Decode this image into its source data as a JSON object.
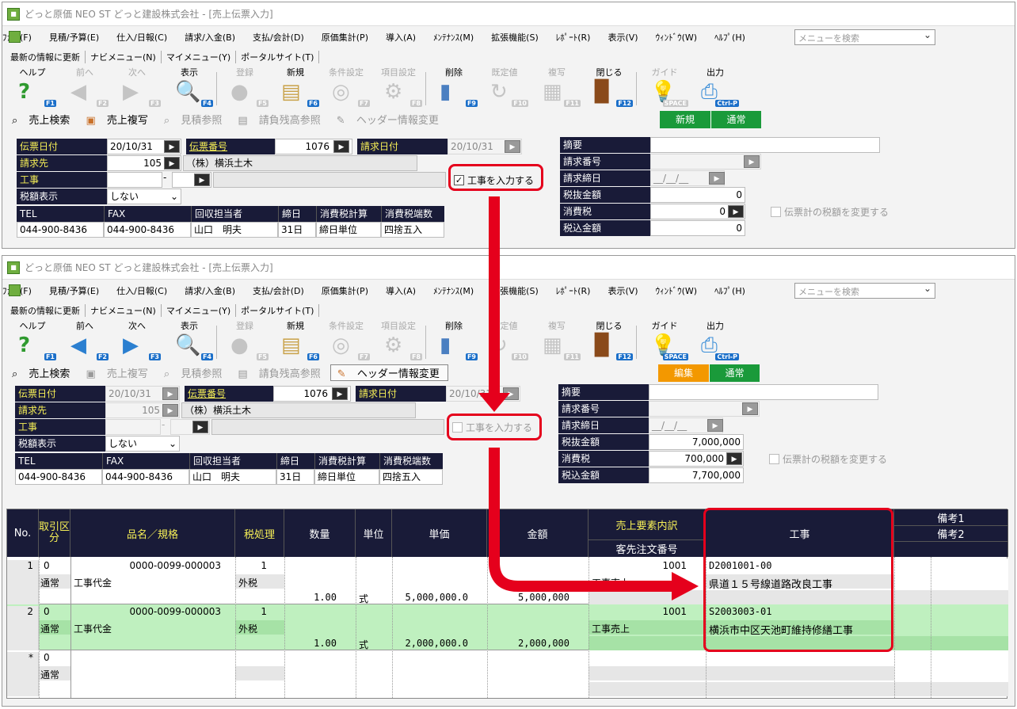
{
  "window_title": "どっと原価 NEO ST どっと建設株式会社 - [売上伝票入力]",
  "menu": [
    "ﾌｧｲﾙ(F)",
    "見積/予算(E)",
    "仕入/日報(C)",
    "請求/入金(B)",
    "支払/会計(D)",
    "原価集計(P)",
    "導入(A)",
    "ﾒﾝﾃﾅﾝｽ(M)",
    "拡張機能(S)",
    "ﾚﾎﾟｰﾄ(R)",
    "表示(V)",
    "ｳｨﾝﾄﾞｳ(W)",
    "ﾍﾙﾌﾟ(H)"
  ],
  "search_placeholder": "メニューを検索",
  "links": [
    "最新の情報に更新",
    "ナビメニュー(N)",
    "マイメニュー(Y)",
    "ポータルサイト(T)"
  ],
  "toolbar": [
    {
      "label": "ヘルプ",
      "key": "F1",
      "icon": "help-icon"
    },
    {
      "label": "前へ",
      "key": "F2",
      "icon": "arrow-left-icon"
    },
    {
      "label": "次へ",
      "key": "F3",
      "icon": "arrow-right-icon"
    },
    {
      "label": "表示",
      "key": "F4",
      "icon": "magnifier-icon"
    },
    {
      "label": "登録",
      "key": "F5",
      "icon": "ok-icon"
    },
    {
      "label": "新規",
      "key": "F6",
      "icon": "new-doc-icon"
    },
    {
      "label": "条件設定",
      "key": "F7",
      "icon": "condition-icon"
    },
    {
      "label": "項目設定",
      "key": "F8",
      "icon": "item-settings-icon"
    },
    {
      "label": "削除",
      "key": "F9",
      "icon": "trash-icon"
    },
    {
      "label": "既定値",
      "key": "F10",
      "icon": "default-icon"
    },
    {
      "label": "複写",
      "key": "F11",
      "icon": "copy-icon"
    },
    {
      "label": "閉じる",
      "key": "F12",
      "icon": "door-icon"
    },
    {
      "label": "ガイド",
      "key": "SPACE",
      "icon": "bulb-icon"
    },
    {
      "label": "出力",
      "key": "Ctrl-P",
      "icon": "output-icon"
    }
  ],
  "subbar": [
    "売上検索",
    "売上複写",
    "見積参照",
    "請負残高参照",
    "ヘッダー情報変更"
  ],
  "modes": {
    "new": "新規",
    "edit": "編集",
    "normal": "通常"
  },
  "header": {
    "slip_date_label": "伝票日付",
    "slip_date": "20/10/31",
    "slip_no_label": "伝票番号",
    "slip_no": "1076",
    "bill_date_label": "請求日付",
    "bill_date": "20/10/31",
    "customer_label": "請求先",
    "customer_code": "105",
    "customer_name": "（株）横浜土木",
    "project_label": "工事",
    "tax_display_label": "税額表示",
    "tax_display": "しない",
    "input_project_label": "工事を入力する",
    "info_headers": [
      "TEL",
      "FAX",
      "回収担当者",
      "締日",
      "消費税計算",
      "消費税端数"
    ],
    "info_values": [
      "044-900-8436",
      "044-900-8436",
      "山口　明夫",
      "31日",
      "締日単位",
      "四捨五入"
    ]
  },
  "summary": {
    "labels": [
      "摘要",
      "請求番号",
      "請求締日",
      "税抜金額",
      "消費税",
      "税込金額"
    ],
    "bill_close": "__/__/__",
    "w1": {
      "net": "0",
      "tax": "0",
      "gross": "0"
    },
    "w2": {
      "net": "7,000,000",
      "tax": "700,000",
      "gross": "7,700,000"
    },
    "change_tax_label": "伝票計の税額を変更する"
  },
  "grid": {
    "headers": {
      "no": "No.",
      "kind": "取引区分",
      "name": "品名／規格",
      "tax": "税処理",
      "qty": "数量",
      "unit": "単位",
      "price": "単価",
      "amount": "金額",
      "elem": "売上要素内訳",
      "order": "客先注文番号",
      "project": "工事",
      "rem1": "備考1",
      "rem2": "備考2"
    },
    "rows": [
      {
        "no": "1",
        "kind_code": "0",
        "kind": "通常",
        "code": "0000-0099-000003",
        "name": "工事代金",
        "tax_code": "1",
        "tax": "外税",
        "qty": "1.00",
        "unit": "式",
        "price": "5,000,000.0",
        "amount": "5,000,000",
        "elem_code": "1001",
        "elem": "工事売上",
        "proj_code": "D2001001-00",
        "proj_name": "県道１５号線道路改良工事"
      },
      {
        "no": "2",
        "kind_code": "0",
        "kind": "通常",
        "code": "0000-0099-000003",
        "name": "工事代金",
        "tax_code": "1",
        "tax": "外税",
        "qty": "1.00",
        "unit": "式",
        "price": "2,000,000.0",
        "amount": "2,000,000",
        "elem_code": "1001",
        "elem": "工事売上",
        "proj_code": "S2003003-01",
        "proj_name": "横浜市中区天池町維持修繕工事"
      },
      {
        "no": "*",
        "kind_code": "0",
        "kind": "通常"
      }
    ]
  }
}
